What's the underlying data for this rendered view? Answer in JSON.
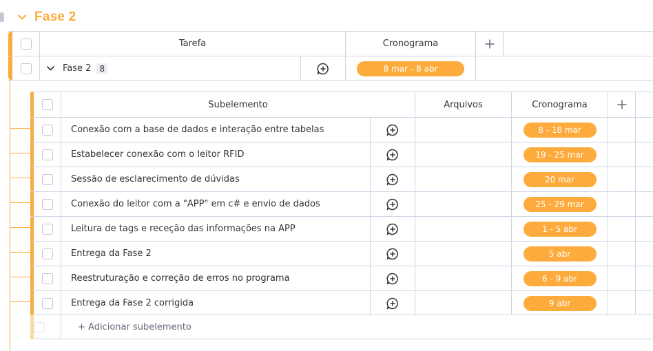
{
  "group": {
    "title": "Fase 2",
    "color": "#fdab3d"
  },
  "main_table": {
    "columns": {
      "task": "Tarefa",
      "timeline": "Cronograma"
    },
    "item": {
      "name": "Fase 2",
      "subitem_count": "8",
      "timeline": "8 mar - 8 abr"
    }
  },
  "sub_table": {
    "columns": {
      "subitem": "Subelemento",
      "files": "Arquivos",
      "timeline": "Cronograma"
    },
    "rows": [
      {
        "name": "Conexão com a base de dados e interação entre tabelas",
        "timeline": "8 - 18 mar"
      },
      {
        "name": "Estabelecer conexão com o leitor RFID",
        "timeline": "19 - 25 mar"
      },
      {
        "name": "Sessão de esclarecimento de dúvidas",
        "timeline": "20 mar"
      },
      {
        "name": "Conexão do leitor com a \"APP\" em c# e envio de dados",
        "timeline": "25 - 29 mar"
      },
      {
        "name": "Leitura de tags e receção das informações na APP",
        "timeline": "1 - 5 abr"
      },
      {
        "name": "Entrega da Fase 2",
        "timeline": "5 abr"
      },
      {
        "name": "Reestruturação e correção de erros no programa",
        "timeline": "6 - 9 abr"
      },
      {
        "name": "Entrega da Fase 2 corrigida",
        "timeline": "9 abr"
      }
    ],
    "add_label": "+ Adicionar subelemento"
  },
  "icons": {
    "group_toggle": "chevron-down-icon",
    "item_toggle": "chevron-down-icon",
    "update": "add-update-icon",
    "add_column": "plus-icon"
  }
}
